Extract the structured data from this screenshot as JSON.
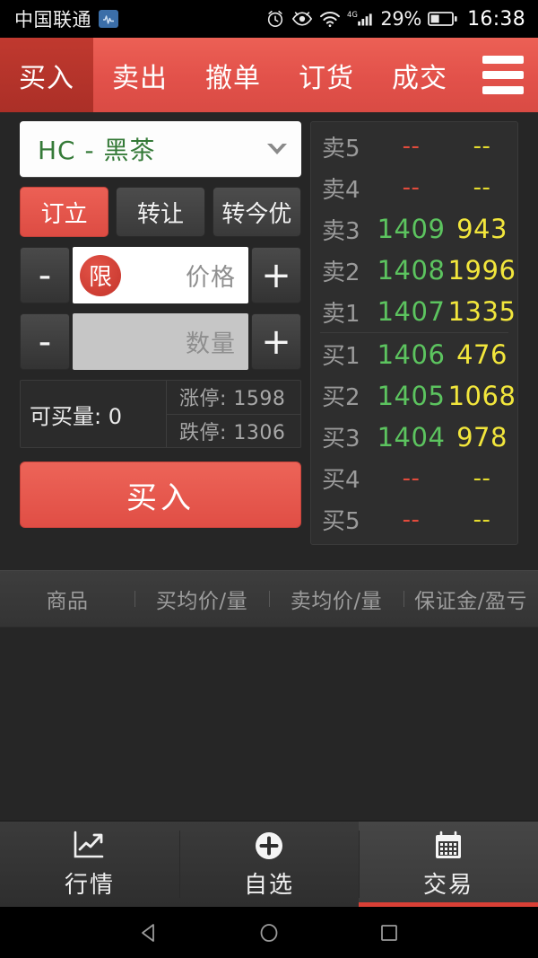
{
  "status_bar": {
    "carrier": "中国联通",
    "sim_icon": "sim-card-icon",
    "alarm_icon": "alarm-clock-icon",
    "eye_icon": "eye-icon",
    "wifi_icon": "wifi-icon",
    "network_type": "4G",
    "signal_icon": "cellular-signal-icon",
    "battery_percent": "29%",
    "battery_icon": "battery-icon",
    "time": "16:38"
  },
  "top_tabs": {
    "items": [
      {
        "label": "买入",
        "active": true
      },
      {
        "label": "卖出",
        "active": false
      },
      {
        "label": "撤单",
        "active": false
      },
      {
        "label": "订货",
        "active": false
      },
      {
        "label": "成交",
        "active": false
      }
    ],
    "menu_icon": "hamburger-menu-icon"
  },
  "order_form": {
    "contract": {
      "value": "HC - 黑茶",
      "chevron_icon": "chevron-down-icon"
    },
    "modes": [
      {
        "label": "订立",
        "active": true
      },
      {
        "label": "转让",
        "active": false
      },
      {
        "label": "转今优",
        "active": false
      }
    ],
    "price_row": {
      "minus": "-",
      "plus": "+",
      "badge": "限",
      "value": "",
      "placeholder": "价格"
    },
    "qty_row": {
      "minus": "-",
      "plus": "+",
      "value": "",
      "placeholder": "数量"
    },
    "available": "可买量: 0",
    "limit_up": "涨停: 1598",
    "limit_down": "跌停: 1306",
    "submit_label": "买入"
  },
  "order_book": {
    "sell": [
      {
        "label": "卖5",
        "price": "--",
        "qty": "--",
        "empty": true
      },
      {
        "label": "卖4",
        "price": "--",
        "qty": "--",
        "empty": true
      },
      {
        "label": "卖3",
        "price": "1409",
        "qty": "943",
        "empty": false
      },
      {
        "label": "卖2",
        "price": "1408",
        "qty": "1996",
        "empty": false
      },
      {
        "label": "卖1",
        "price": "1407",
        "qty": "1335",
        "empty": false
      }
    ],
    "buy": [
      {
        "label": "买1",
        "price": "1406",
        "qty": "476",
        "empty": false
      },
      {
        "label": "买2",
        "price": "1405",
        "qty": "1068",
        "empty": false
      },
      {
        "label": "买3",
        "price": "1404",
        "qty": "978",
        "empty": false
      },
      {
        "label": "买4",
        "price": "--",
        "qty": "--",
        "empty": true
      },
      {
        "label": "买5",
        "price": "--",
        "qty": "--",
        "empty": true
      }
    ]
  },
  "position_header": {
    "columns": [
      "商品",
      "买均价/量",
      "卖均价/量",
      "保证金/盈亏"
    ]
  },
  "bottom_nav": {
    "items": [
      {
        "label": "行情",
        "icon": "chart-trend-icon",
        "active": false
      },
      {
        "label": "自选",
        "icon": "plus-circle-icon",
        "active": false
      },
      {
        "label": "交易",
        "icon": "calendar-icon",
        "active": true
      }
    ]
  },
  "android_nav": {
    "back_icon": "triangle-back-icon",
    "home_icon": "circle-home-icon",
    "recents_icon": "square-recents-icon"
  },
  "colors": {
    "accent_red": "#e2514a",
    "active_tab_red": "#b5312c",
    "price_green": "#5cc45f",
    "qty_yellow": "#f2e63c",
    "empty_red": "#e24b3c",
    "contract_green": "#357a38",
    "bg_dark": "#262626",
    "panel_dark": "#2e2e2e"
  }
}
